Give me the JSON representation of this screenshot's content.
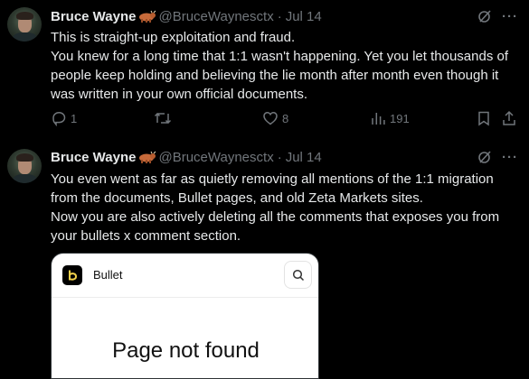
{
  "tweets": [
    {
      "author_name": "Bruce Wayne",
      "handle": "@BruceWaynesctx",
      "separator": "·",
      "date": "Jul 14",
      "lines": [
        "This is straight-up exploitation and fraud.",
        "You knew for a long time that 1:1 wasn't happening. Yet you let thousands of",
        "people keep holding and believing the lie month after month even though it",
        "was written in your own official documents."
      ],
      "actions": {
        "reply_count": "1",
        "repost_count": "",
        "like_count": "8",
        "view_count": "191"
      }
    },
    {
      "author_name": "Bruce Wayne",
      "handle": "@BruceWaynesctx",
      "separator": "·",
      "date": "Jul 14",
      "lines": [
        "You even went as far as quietly removing all mentions of the 1:1 migration",
        "from the documents, Bullet pages, and old Zeta Markets sites.",
        "Now you are also actively deleting all the comments that exposes you from",
        "your bullets x comment section."
      ],
      "media": {
        "brand": "Bullet",
        "title": "Page not found"
      }
    }
  ],
  "icons": {
    "name_emoji": "ox-emoji",
    "grok": "grok-icon",
    "more": "more-icon",
    "reply": "reply-icon",
    "repost": "repost-icon",
    "like": "heart-icon",
    "views": "views-icon",
    "bookmark": "bookmark-icon",
    "share": "share-icon",
    "search": "search-icon"
  },
  "colors": {
    "background": "#000000",
    "text": "#e7e9ea",
    "secondary": "#71767b",
    "card_background": "#ffffff"
  }
}
